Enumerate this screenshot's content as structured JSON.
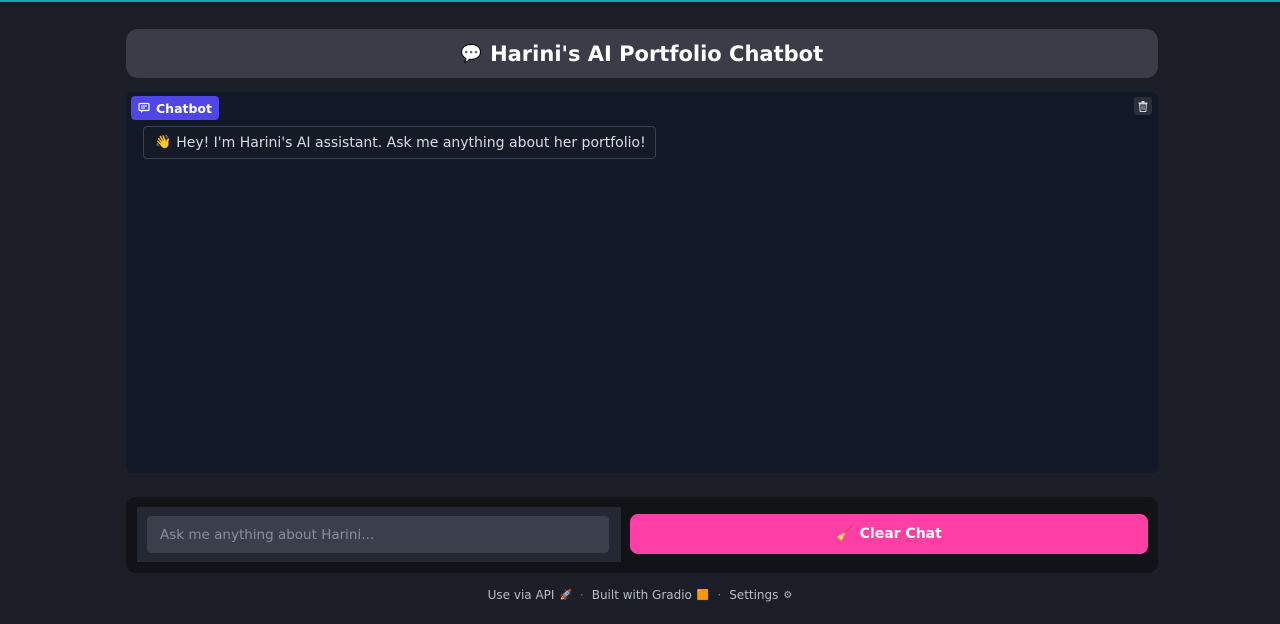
{
  "header": {
    "icon": "speech-bubble-icon",
    "icon_glyph": "💬",
    "title": "Harini's AI Portfolio Chatbot"
  },
  "chatbot": {
    "label": "Chatbot",
    "messages": [
      {
        "role": "assistant",
        "emoji": "👋",
        "text": "Hey! I'm Harini's AI assistant. Ask me anything about her portfolio!"
      }
    ]
  },
  "input": {
    "placeholder": "Ask me anything about Harini...",
    "value": ""
  },
  "clear_button": {
    "emoji": "🧹",
    "label": "Clear Chat"
  },
  "footer": {
    "api_label": "Use via API",
    "api_icon": "🚀",
    "built_label": "Built with Gradio",
    "built_icon": "🟧",
    "settings_label": "Settings",
    "settings_icon": "⚙",
    "separator": "·"
  },
  "colors": {
    "accent": "#ff3ea6",
    "chip": "#4f46e5",
    "panel": "#111827"
  }
}
